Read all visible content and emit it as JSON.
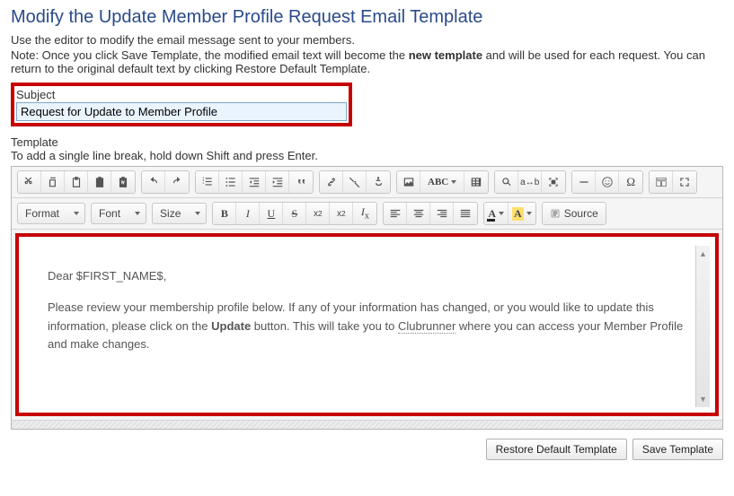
{
  "page": {
    "title": "Modify the Update Member Profile Request Email Template",
    "intro1": "Use the editor to modify the email message sent to your members.",
    "intro2_pre": "Note: Once you click Save Template, the modified email text will become the ",
    "intro2_bold": "new template",
    "intro2_post": " and will be used for each request. You can return to the original default text by clicking Restore Default Template."
  },
  "subject": {
    "label": "Subject",
    "value": "Request for Update to Member Profile"
  },
  "template": {
    "label": "Template",
    "hint": "To add a single line break, hold down Shift and press Enter."
  },
  "toolbar": {
    "format": "Format",
    "font": "Font",
    "size": "Size",
    "source": "Source"
  },
  "body": {
    "greeting": "Dear $FIRST_NAME$,",
    "p1a": "Please review your membership profile below. If any of your information has changed, or you would like to update this information, please click on the ",
    "p1_bold": "Update",
    "p1b": " button. This will take you to ",
    "p1_link": "Clubrunner",
    "p1c": " where you can access your Member Profile and make changes."
  },
  "footer": {
    "restore": "Restore Default Template",
    "save": "Save Template"
  }
}
